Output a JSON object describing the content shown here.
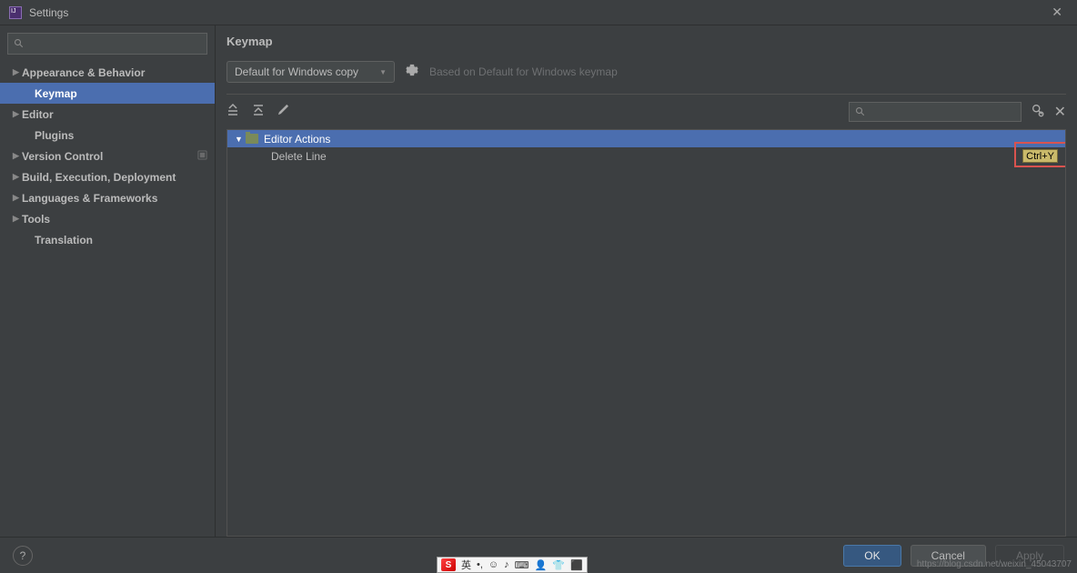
{
  "window": {
    "title": "Settings"
  },
  "sidebar": {
    "items": [
      {
        "label": "Appearance & Behavior",
        "bold": true,
        "arrow": true
      },
      {
        "label": "Keymap",
        "bold": true,
        "arrow": false,
        "indent": true,
        "selected": true
      },
      {
        "label": "Editor",
        "bold": true,
        "arrow": true
      },
      {
        "label": "Plugins",
        "bold": true,
        "arrow": false,
        "indent": true
      },
      {
        "label": "Version Control",
        "bold": true,
        "arrow": true,
        "trail": true
      },
      {
        "label": "Build, Execution, Deployment",
        "bold": true,
        "arrow": true
      },
      {
        "label": "Languages & Frameworks",
        "bold": true,
        "arrow": true
      },
      {
        "label": "Tools",
        "bold": true,
        "arrow": true
      },
      {
        "label": "Translation",
        "bold": true,
        "arrow": false,
        "indent": true
      }
    ]
  },
  "main": {
    "title": "Keymap",
    "scheme_selected": "Default for Windows copy",
    "based_on": "Based on Default for Windows keymap",
    "tree": {
      "group": "Editor Actions",
      "action": "Delete Line",
      "shortcut": "Ctrl+Y"
    }
  },
  "footer": {
    "ok": "OK",
    "cancel": "Cancel",
    "apply": "Apply"
  },
  "ime": {
    "glyphs": [
      "英",
      "•,",
      "☺",
      "♪",
      "⌨",
      "👤",
      "👕",
      "⬛"
    ]
  },
  "watermark": "https://blog.csdn.net/weixin_45043707"
}
